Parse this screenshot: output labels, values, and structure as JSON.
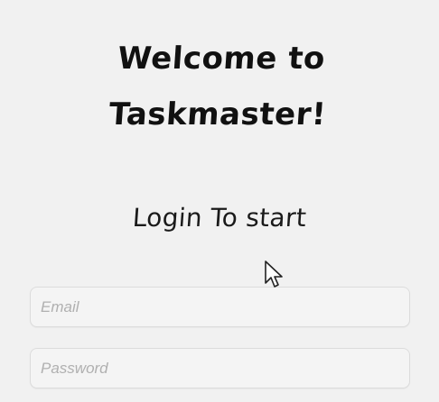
{
  "welcome": {
    "line1": "Welcome to",
    "line2": "Taskmaster!"
  },
  "subtitle": "Login To start",
  "email": {
    "placeholder": "Email",
    "value": ""
  },
  "password": {
    "placeholder": "Password",
    "value": ""
  },
  "cursor": {
    "icon": "pointer-arrow-icon"
  }
}
